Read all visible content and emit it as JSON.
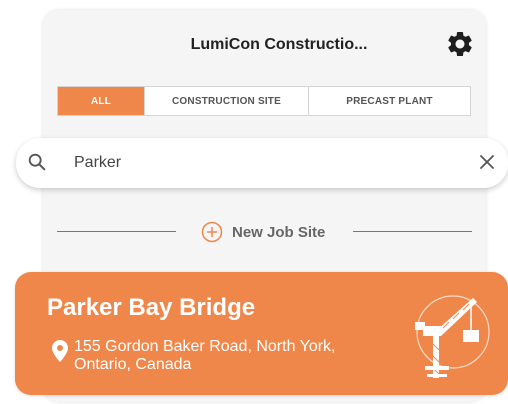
{
  "header": {
    "title": "LumiCon Constructio...",
    "settings_icon": "gear-icon"
  },
  "tabs": [
    {
      "label": "ALL",
      "active": true
    },
    {
      "label": "CONSTRUCTION SITE",
      "active": false
    },
    {
      "label": "PRECAST PLANT",
      "active": false
    }
  ],
  "search": {
    "value": "Parker",
    "search_icon": "search-icon",
    "clear_icon": "close-icon"
  },
  "new_job": {
    "label": "New Job Site",
    "icon": "plus-circle-icon"
  },
  "job_card": {
    "name": "Parker Bay Bridge",
    "address_line1": "155 Gordon Baker Road, North York,",
    "address_line2": "Ontario, Canada",
    "location_icon": "location-pin-icon",
    "site_icon": "crane-icon"
  },
  "colors": {
    "accent": "#f0874a",
    "panel": "#f5f5f5",
    "text_dark": "#222222"
  }
}
